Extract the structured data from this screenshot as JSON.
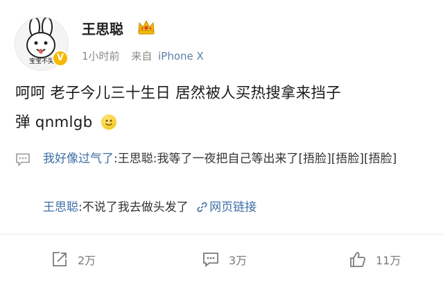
{
  "post": {
    "username": "王思聪",
    "time": "1小时前",
    "source_prefix": "来自",
    "device": "iPhone X",
    "avatar_caption": "宝宝不哭",
    "text_line1": "呵呵 老子今儿三十生日 居然被人买热搜拿来挡子",
    "text_line2": "弹 qnmlgb"
  },
  "hot_comment": {
    "user": "我好像过气了",
    "text": ":王思聪:我等了一夜把自己等出来了[捂脸][捂脸][捂脸]"
  },
  "reply": {
    "user": "王思聪",
    "text": ":不说了我去做头发了",
    "link_label": "网页链接"
  },
  "actions": {
    "repost_count": "2万",
    "comment_count": "3万",
    "like_count": "11万"
  },
  "colors": {
    "link_blue": "#3e6ea7",
    "meta_gray": "#8a8a8a",
    "verified_gold": "#f6b800",
    "crown_gold": "#f2b90f",
    "crown_red": "#d93b2b"
  },
  "icons": [
    "avatar-cartoon",
    "verified-badge-icon",
    "crown-icon",
    "smile-emoji-icon",
    "comment-icon",
    "link-icon",
    "repost-icon",
    "comment-action-icon",
    "like-icon"
  ]
}
